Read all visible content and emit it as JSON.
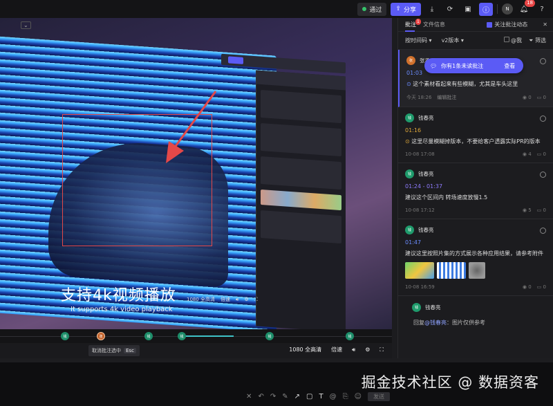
{
  "topbar": {
    "pass_label": "通过",
    "share_label": "分享",
    "user_initial": "N",
    "notification_count": "18",
    "help": "?"
  },
  "video": {
    "subtitle_cn": "支持4k视频播放",
    "subtitle_en": "It supports 4k video playback",
    "inner_quality": "1080 全高清",
    "inner_speed": "倍速"
  },
  "timeline": {
    "markers": [
      "钱",
      "张",
      "钱",
      "钱",
      "钱",
      "钱"
    ],
    "highlight_index": 1
  },
  "controls": {
    "esc_hint": "取消批注选中",
    "esc_key": "Esc",
    "quality": "1080 全高清",
    "speed": "倍速"
  },
  "panel": {
    "tab_comments": "批注",
    "tab_comments_badge": "1",
    "tab_file_info": "文件信息",
    "follow_label": "关注批注动态",
    "filter_sort": "按时间码",
    "filter_version": "v2版本",
    "filter_mine": "@我",
    "filter_label": "筛选",
    "notification": {
      "text": "你有1条未读批注",
      "action": "查看"
    },
    "comments": [
      {
        "author": "张丞",
        "avatar": "张",
        "timecode": "01:03",
        "text": "这个素材看起来有些模糊，尤其是车头这里",
        "date": "今天 18:26",
        "edit": "编辑批注",
        "views": "0",
        "replies": "0"
      },
      {
        "author": "钱春亮",
        "avatar": "钱",
        "timecode": "01:16",
        "text": "这里尽量模糊掉版本，不要给客户透露实际PR的版本",
        "date": "10-08 17:08",
        "views": "4",
        "replies": "0"
      },
      {
        "author": "钱春亮",
        "avatar": "钱",
        "timecode": "01:24 - 01:37",
        "text": "建议这个区间内 转场速度放慢1.5",
        "date": "10-08 17:12",
        "views": "5",
        "replies": "0"
      },
      {
        "author": "钱春亮",
        "avatar": "钱",
        "timecode": "01:47",
        "text": "建议这里按照片集的方式展示各种应用结果，请参考附件",
        "date": "10-08 16:59",
        "views": "0",
        "replies": "0"
      }
    ],
    "reply": {
      "author": "钱春亮",
      "avatar": "钱",
      "prefix": "回复",
      "mention": "@钱春亮",
      "text": "：图片仅供参考"
    }
  },
  "bottom": {
    "send_label": "发送",
    "watermark": "掘金技术社区 @ 数据资客"
  },
  "colors": {
    "accent": "#5b5bf5",
    "selection_box": "#e34848",
    "marker_green": "#1e8e6a",
    "badge_red": "#e94545"
  }
}
